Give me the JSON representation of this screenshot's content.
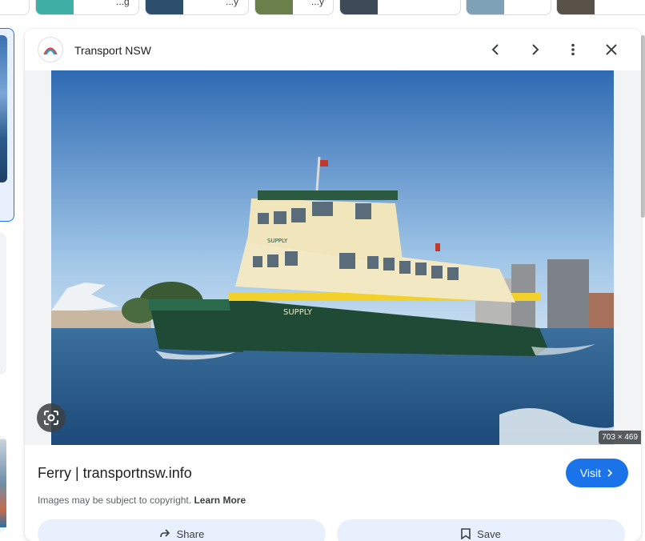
{
  "strip": {
    "chips": [
      {
        "label": ""
      },
      {
        "label": "...g"
      },
      {
        "label": "...y"
      },
      {
        "label": "...y"
      },
      {
        "label": ""
      },
      {
        "label": ""
      },
      {
        "label": ""
      }
    ]
  },
  "panel": {
    "source": "Transport NSW",
    "image_dims": "703 × 469",
    "title": "Ferry | transportnsw.info",
    "visit_label": "Visit",
    "copyright_text": "Images may be subject to copyright.",
    "learn_more": "Learn More",
    "share_label": "Share",
    "save_label": "Save"
  },
  "photo": {
    "ferry_name_bow": "SUPPLY",
    "ferry_name_hull": "SUPPLY"
  },
  "colors": {
    "accent": "#1a73e8",
    "sky_top": "#2f6db5",
    "hull_green": "#1f4a35",
    "deck_cream": "#f2e9c4",
    "water": "#2d5f8f"
  }
}
